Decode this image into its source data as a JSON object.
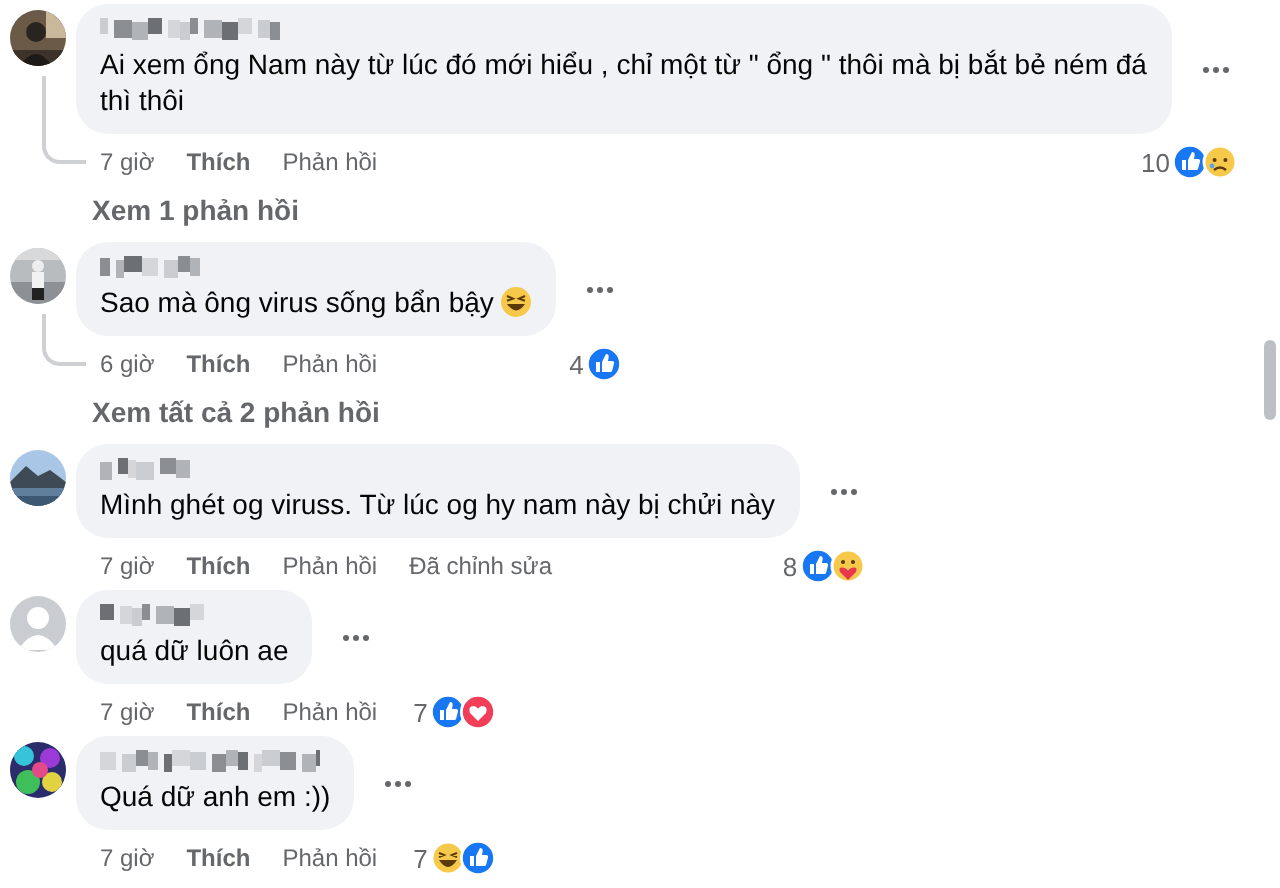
{
  "comments": [
    {
      "text": "Ai xem ổng Nam này từ lúc đó mới hiểu , chỉ một từ \" ổng \" thôi mà bị bắt bẻ ném đá thì thôi",
      "time": "7 giờ",
      "like": "Thích",
      "reply": "Phản hồi",
      "reactions": {
        "count": "10",
        "icons": [
          {
            "kind": "like"
          },
          {
            "kind": "sad"
          }
        ]
      },
      "replies_link": "Xem 1 phản hồi"
    },
    {
      "text": "Sao mà ông virus sống bẩn bậy",
      "emoji": {
        "kind": "laughing"
      },
      "time": "6 giờ",
      "like": "Thích",
      "reply": "Phản hồi",
      "reactions": {
        "count": "4",
        "icons": [
          {
            "kind": "like"
          }
        ]
      },
      "replies_link": "Xem tất cả 2 phản hồi"
    },
    {
      "text": "Mình ghét og viruss. Từ lúc og hy nam này bị chửi này",
      "time": "7 giờ",
      "like": "Thích",
      "reply": "Phản hồi",
      "edited": "Đã chỉnh sửa",
      "reactions": {
        "count": "8",
        "icons": [
          {
            "kind": "like"
          },
          {
            "kind": "care"
          }
        ]
      }
    },
    {
      "avatar": {
        "kind": "default"
      },
      "text": "quá dữ luôn ae",
      "time": "7 giờ",
      "like": "Thích",
      "reply": "Phản hồi",
      "reactions": {
        "count": "7",
        "icons": [
          {
            "kind": "like"
          },
          {
            "kind": "love"
          }
        ]
      }
    },
    {
      "text": "Quá dữ anh em :))",
      "time": "7 giờ",
      "like": "Thích",
      "reply": "Phản hồi",
      "reactions": {
        "count": "7",
        "icons": [
          {
            "kind": "haha"
          },
          {
            "kind": "like"
          }
        ]
      }
    }
  ]
}
